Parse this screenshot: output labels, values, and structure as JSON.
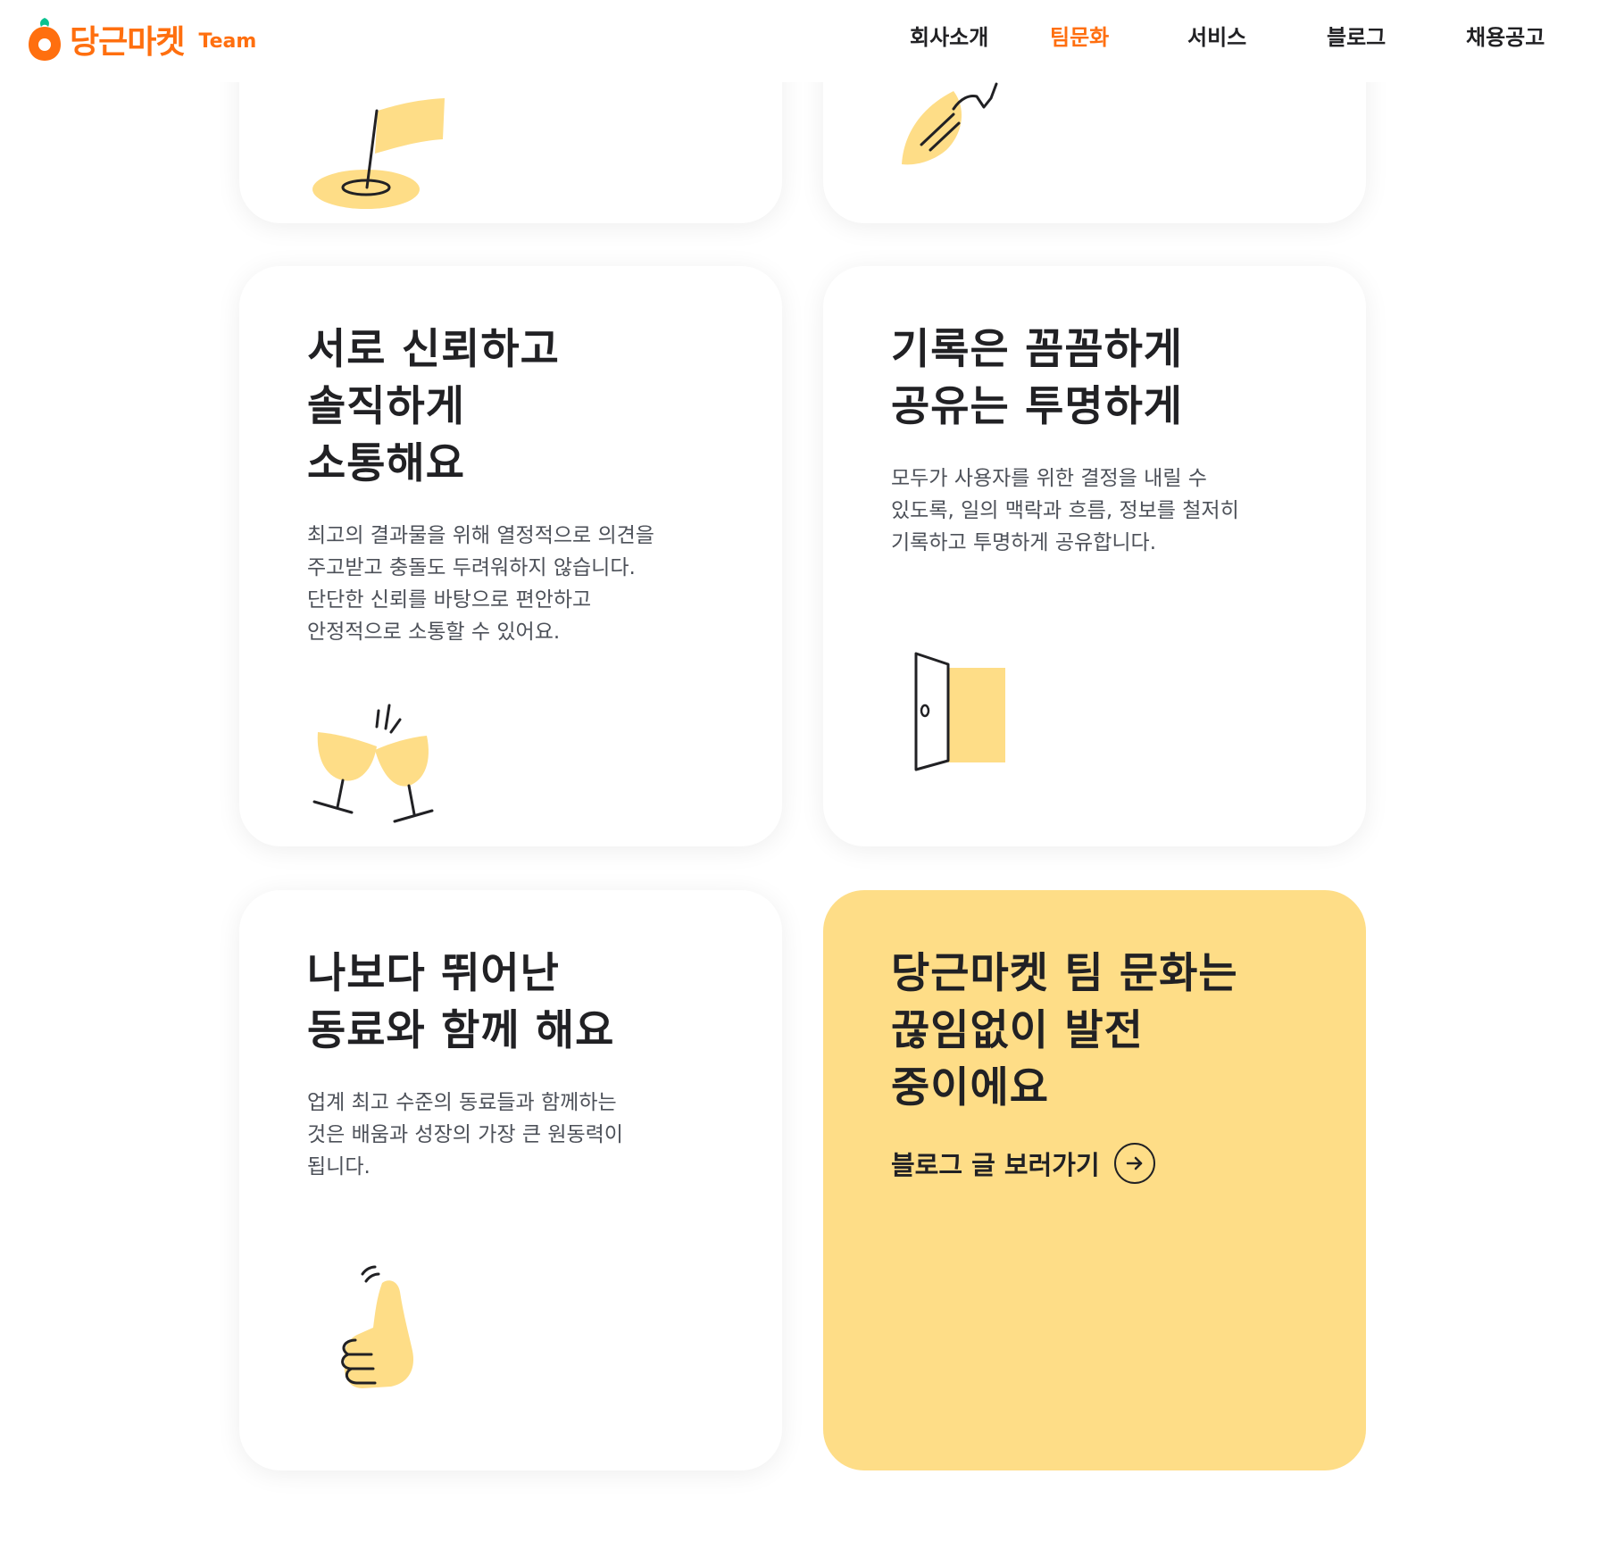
{
  "header": {
    "logo_word": "당근마켓",
    "logo_team": "Team",
    "nav": [
      {
        "label": "회사소개",
        "active": false
      },
      {
        "label": "팀문화",
        "active": true
      },
      {
        "label": "서비스",
        "active": false
      },
      {
        "label": "블로그",
        "active": false
      },
      {
        "label": "채용공고",
        "active": false
      }
    ]
  },
  "cards": {
    "trust": {
      "title": "서로 신뢰하고\n솔직하게\n소통해요",
      "description": "최고의 결과물을 위해 열정적으로 의견을\n주고받고 충돌도 두려워하지 않습니다.\n단단한 신뢰를 바탕으로 편안하고\n안정적으로 소통할 수 있어요.",
      "illustration": "cheers-glasses-icon"
    },
    "record": {
      "title": "기록은 꼼꼼하게\n공유는 투명하게",
      "description": "모두가 사용자를 위한 결정을 내릴 수\n있도록, 일의 맥락과 흐름, 정보를 철저히\n기록하고 투명하게 공유합니다.",
      "illustration": "open-door-icon"
    },
    "colleagues": {
      "title": "나보다 뛰어난\n동료와 함께 해요",
      "description": "업계 최고 수준의 동료들과 함께하는\n것은 배움과 성장의 가장 큰 원동력이\n됩니다.",
      "illustration": "thumbs-up-icon"
    },
    "growing": {
      "title": "당근마켓 팀 문화는\n끊임없이 발전\n중이에요",
      "link_label": "블로그 글 보러가기"
    },
    "top_left": {
      "illustration": "flag-icon"
    },
    "top_right": {
      "illustration": "rocket-icon"
    }
  },
  "colors": {
    "brand": "#ff6f0f",
    "accent_yellow": "#fedd87",
    "text": "#212124",
    "subtext": "#4d5159"
  }
}
